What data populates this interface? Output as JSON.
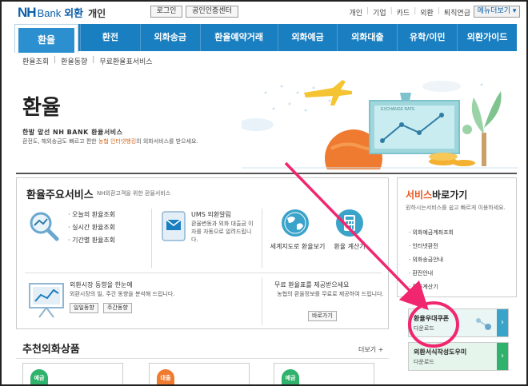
{
  "header": {
    "logo_nh": "NH",
    "logo_bank": "Bank",
    "logo_fx": "외환",
    "logo_personal": "개인",
    "login": "로그인",
    "cert_center": "공인인증센터",
    "util_links": [
      "개인",
      "기업",
      "카드",
      "외환",
      "퇴직연금"
    ],
    "more_menu": "메뉴더보기 ▾"
  },
  "gnb": {
    "active": "환율",
    "items": [
      "환전",
      "외화송금",
      "환율예약거래",
      "외화예금",
      "외화대출",
      "유학/이민",
      "외환가이드"
    ]
  },
  "breadcrumb": [
    "환율조회",
    "환율동향",
    "무료환율표서비스"
  ],
  "hero": {
    "title": "환율",
    "subtitle": "한발 앞선 NH BANK 환율서비스",
    "desc_before": "환전도, 해외송금도 빠르고 편한 ",
    "desc_em": "농협 인터넷뱅킹",
    "desc_after": "의 외화서비스를 받으세요.",
    "chart_label": "EXCHANGE RATE"
  },
  "services": {
    "title": "환율주요서비스",
    "title_sub": "NH외환고객을 위한 환율서비스",
    "list": [
      "오늘의 환율조회",
      "실시간 환율조회",
      "기간별 환율조회"
    ],
    "ums_title": "UMS 외환알림",
    "ums_desc": "환율변동과 외화 대출금 이자를 자동으로 알려드립니다.",
    "globe_label": "세계지도로 환율보기",
    "calc_label": "환율 계산기",
    "market_title": "외환시장 동향을 한눈에",
    "market_desc": "외환시장의 일, 주간 동향을 분석해 드립니다.",
    "daily_btn": "일일동향",
    "weekly_btn": "주간동향",
    "free_title": "무료 환율표를 제공받으세요",
    "free_desc": "농협의 환율정보를 무료로 제공하여 드립니다.",
    "go_btn": "바로가기"
  },
  "shortcuts": {
    "title_accent": "서비스",
    "title_rest": "바로가기",
    "desc": "원하시는서비스를 쉽고 빠르게 이용하세요.",
    "list": [
      "외화예금계좌조회",
      "인터넷환전",
      "외화송금안내",
      "환전안내",
      "환율계산기"
    ]
  },
  "coupons": [
    {
      "title": "환율우대쿠폰",
      "sub": "다운로드"
    },
    {
      "title": "외환서식작성도우미",
      "sub": "다운로드"
    }
  ],
  "recommended": {
    "title": "추천외화상품",
    "more": "더보기 +",
    "badges": [
      "예금",
      "대출",
      "예금"
    ]
  },
  "colors": {
    "brand_blue": "#1a7fc1",
    "accent_orange": "#e8531a",
    "annotation_pink": "#f0266e"
  }
}
